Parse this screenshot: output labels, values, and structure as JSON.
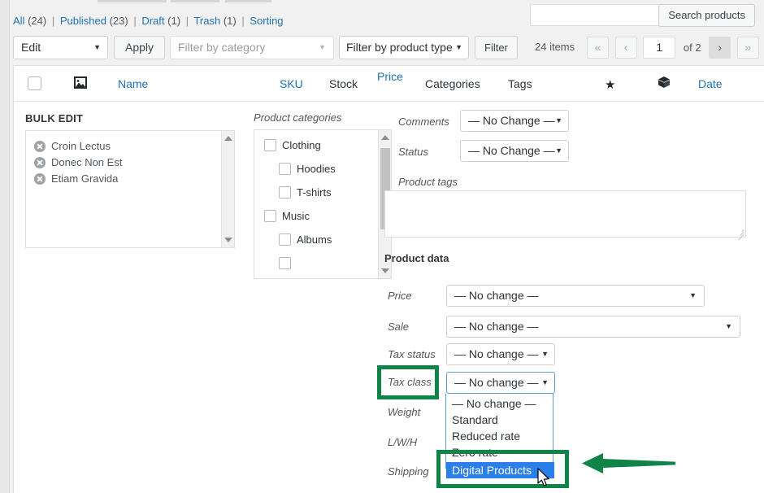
{
  "views": {
    "items": [
      {
        "label": "All",
        "count": "(24)",
        "link": true
      },
      {
        "label": "Published",
        "count": "(23)",
        "link": true
      },
      {
        "label": "Draft",
        "count": "(1)",
        "link": true
      },
      {
        "label": "Trash",
        "count": "(1)",
        "link": true
      },
      {
        "label": "Sorting",
        "count": "",
        "link": true
      }
    ],
    "separator": "|"
  },
  "search": {
    "value": "",
    "placeholder": "",
    "button_label": "Search products"
  },
  "toolbar": {
    "bulk_action_value": "Edit",
    "apply_label": "Apply",
    "category_filter_placeholder": "Filter by category",
    "product_type_filter_value": "Filter by product type",
    "filter_label": "Filter"
  },
  "pagination": {
    "item_count": "24 items",
    "first_label": "«",
    "prev_label": "‹",
    "current_page": "1",
    "of_label": "of 2",
    "next_label": "›",
    "last_label": "»"
  },
  "table_headers": {
    "image": "image-icon",
    "name": "Name",
    "sku": "SKU",
    "stock": "Stock",
    "price": "Price",
    "categories": "Categories",
    "tags": "Tags",
    "featured": "★",
    "product_type": "product-type-icon",
    "date": "Date"
  },
  "bulk_edit": {
    "title": "BULK EDIT",
    "products": [
      "Croin Lectus",
      "Donec Non Est",
      "Etiam Gravida"
    ],
    "categories_label": "Product categories",
    "categories": [
      {
        "label": "Clothing",
        "indent": 0,
        "checked": false
      },
      {
        "label": "Hoodies",
        "indent": 1,
        "checked": false
      },
      {
        "label": "T-shirts",
        "indent": 1,
        "checked": false
      },
      {
        "label": "Music",
        "indent": 0,
        "checked": false
      },
      {
        "label": "Albums",
        "indent": 1,
        "checked": false
      }
    ],
    "comments_label": "Comments",
    "comments_value": "— No Change —",
    "status_label": "Status",
    "status_value": "— No Change —",
    "product_tags_label": "Product tags",
    "product_tags_value": ""
  },
  "product_data": {
    "title": "Product data",
    "price_label": "Price",
    "price_value": "— No change —",
    "sale_label": "Sale",
    "sale_value": "— No change —",
    "tax_status_label": "Tax status",
    "tax_status_value": "— No change —",
    "tax_class_label": "Tax class",
    "tax_class_value": "— No change —",
    "weight_label": "Weight",
    "lwh_label": "L/W/H",
    "shipping_label": "Shipping",
    "tax_class_options": [
      {
        "label": "— No change —",
        "selected": false
      },
      {
        "label": "Standard",
        "selected": false
      },
      {
        "label": "Reduced rate",
        "selected": false
      },
      {
        "label": "Zero rate",
        "selected": false
      },
      {
        "label": "Digital Products",
        "selected": true
      }
    ]
  },
  "annotations": {
    "highlight_color": "#0f8348",
    "highlighted_elements": [
      "Tax class",
      "Digital Products"
    ],
    "arrow_direction": "left",
    "selected_option_color": "#2a7fe8"
  }
}
